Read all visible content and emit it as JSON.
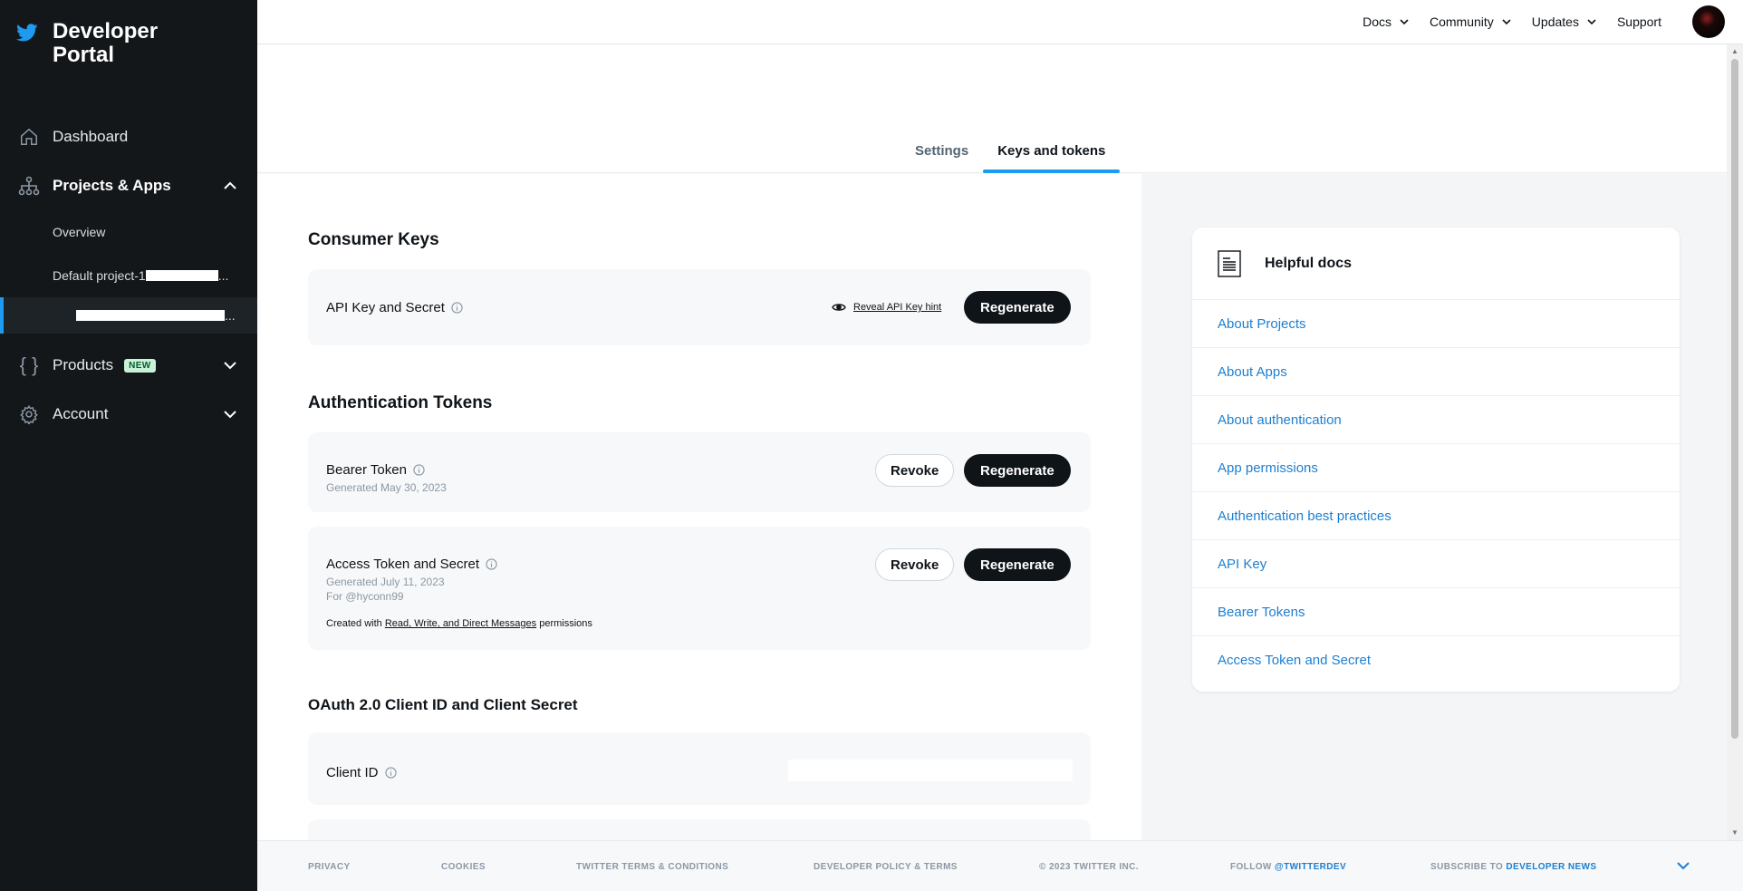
{
  "sidebar": {
    "brand": "Developer Portal",
    "brand_line1": "Developer",
    "brand_line2": "Portal",
    "items": {
      "dashboard": "Dashboard",
      "projects": "Projects & Apps",
      "overview": "Overview",
      "default_project": "Default project-1",
      "products": "Products",
      "products_badge": "NEW",
      "account": "Account"
    }
  },
  "topnav": {
    "docs": "Docs",
    "community": "Community",
    "updates": "Updates",
    "support": "Support"
  },
  "tabs": [
    "Settings",
    "Keys and tokens"
  ],
  "active_tab": "Keys and tokens",
  "consumer_keys": {
    "title": "Consumer Keys",
    "api_key_label": "API Key and Secret",
    "reveal_label": "Reveal API Key hint",
    "regenerate": "Regenerate"
  },
  "auth_tokens": {
    "title": "Authentication Tokens",
    "bearer": {
      "label": "Bearer Token",
      "generated": "Generated May 30, 2023",
      "revoke": "Revoke",
      "regenerate": "Regenerate"
    },
    "access": {
      "label": "Access Token and Secret",
      "generated": "Generated July 11, 2023",
      "for_user": "For @hyconn99",
      "created_with": "Created with",
      "permissions_link": "Read, Write, and Direct Messages",
      "permissions_suffix": "permissions",
      "revoke": "Revoke",
      "regenerate": "Regenerate"
    }
  },
  "oauth": {
    "title": "OAuth 2.0 Client ID and Client Secret",
    "client_id_label": "Client ID"
  },
  "helpful_docs": {
    "title": "Helpful docs",
    "links": [
      "About Projects",
      "About Apps",
      "About authentication",
      "App permissions",
      "Authentication best practices",
      "API Key",
      "Bearer Tokens",
      "Access Token and Secret"
    ]
  },
  "footer": {
    "privacy": "PRIVACY",
    "cookies": "COOKIES",
    "terms": "TWITTER TERMS & CONDITIONS",
    "policy": "DEVELOPER POLICY & TERMS",
    "copyright": "© 2023 TWITTER INC.",
    "follow_prefix": "FOLLOW",
    "follow_handle": "@TWITTERDEV",
    "subscribe_prefix": "SUBSCRIBE TO",
    "subscribe_link": "DEVELOPER NEWS"
  },
  "colors": {
    "sidebar_bg": "#14171a",
    "accent": "#1d9bf0",
    "link": "#1d7fd1"
  }
}
